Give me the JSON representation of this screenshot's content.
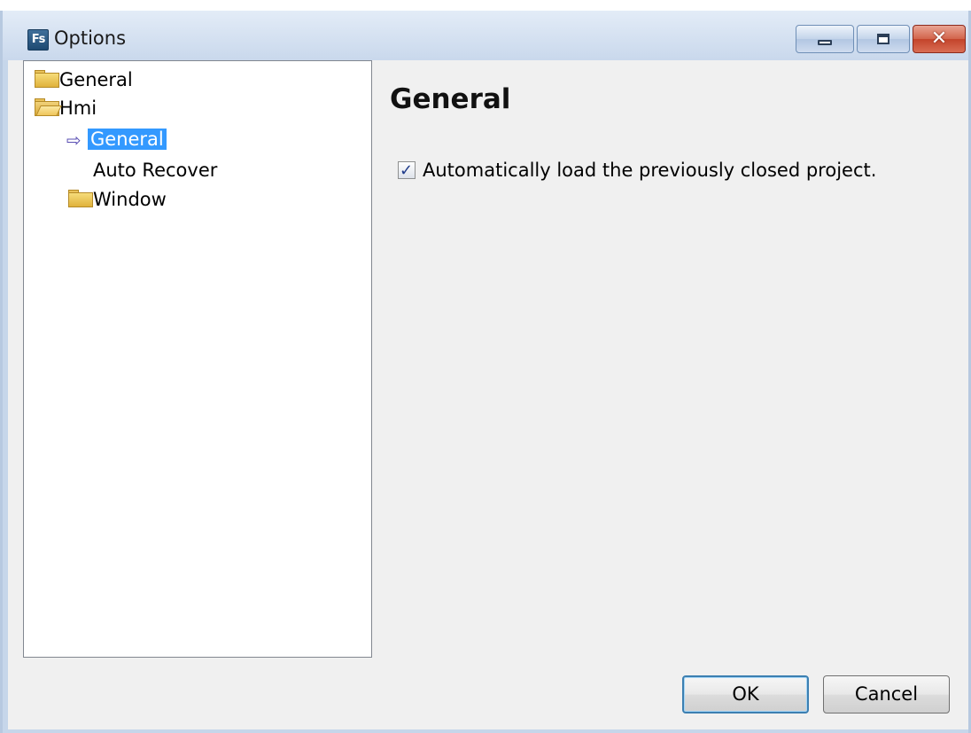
{
  "window": {
    "title": "Options",
    "app_icon_text": "Fs"
  },
  "tree": {
    "items": [
      {
        "label": "General",
        "icon": "folder-icon"
      },
      {
        "label": "Hmi",
        "icon": "folder-open-icon"
      },
      {
        "label": "General",
        "icon": "arrow-right-icon",
        "selected": true
      },
      {
        "label": "Auto Recover"
      },
      {
        "label": "Window",
        "icon": "folder-icon"
      }
    ]
  },
  "panel": {
    "heading": "General",
    "options": [
      {
        "label": "Automatically load the previously closed project.",
        "checked": true
      }
    ]
  },
  "buttons": {
    "ok": "OK",
    "cancel": "Cancel"
  },
  "colors": {
    "selection": "#3399ff",
    "client_bg": "#f0f0f0",
    "frame": "#c6d6ea"
  }
}
